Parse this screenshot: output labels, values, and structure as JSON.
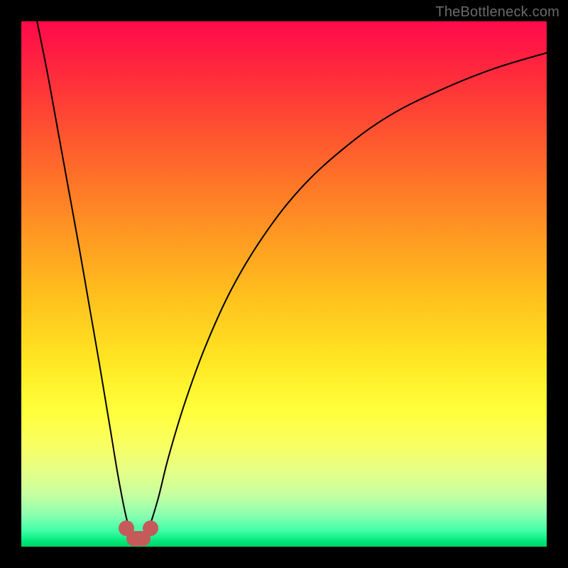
{
  "watermark": {
    "text": "TheBottleneck.com"
  },
  "chart_data": {
    "type": "line",
    "title": "",
    "xlabel": "",
    "ylabel": "",
    "xlim": [
      0,
      100
    ],
    "ylim": [
      0,
      100
    ],
    "grid": false,
    "series": [
      {
        "name": "left-branch",
        "color": "#000000",
        "x": [
          3,
          5,
          7,
          9,
          11,
          13,
          15,
          17,
          18.5,
          20,
          21
        ],
        "y": [
          100,
          90,
          79,
          68,
          57,
          45.5,
          34,
          22,
          13,
          5.5,
          2.5
        ]
      },
      {
        "name": "right-branch",
        "color": "#000000",
        "x": [
          24,
          26,
          28,
          31,
          35,
          40,
          46,
          53,
          61,
          70,
          80,
          90,
          100
        ],
        "y": [
          2.5,
          9,
          17,
          27,
          38,
          49,
          59,
          68,
          75.5,
          82,
          87,
          91,
          94
        ]
      }
    ],
    "markers": [
      {
        "name": "valley-left-dot",
        "x": 20.0,
        "y": 3.5,
        "r_pct": 1.5,
        "color": "#c45a5a"
      },
      {
        "name": "valley-right-dot",
        "x": 24.6,
        "y": 3.5,
        "r_pct": 1.5,
        "color": "#c45a5a"
      },
      {
        "name": "valley-bridge",
        "x": 22.3,
        "y": 1.6,
        "w_pct": 4.6,
        "h_pct": 2.8,
        "rounded": true,
        "color": "#c45a5a"
      }
    ],
    "background_gradient": {
      "direction": "vertical",
      "stops": [
        {
          "pos": 0.0,
          "color": "#ff0a4a"
        },
        {
          "pos": 0.4,
          "color": "#ff9622"
        },
        {
          "pos": 0.74,
          "color": "#ffff3a"
        },
        {
          "pos": 1.0,
          "color": "#00d060"
        }
      ]
    }
  }
}
